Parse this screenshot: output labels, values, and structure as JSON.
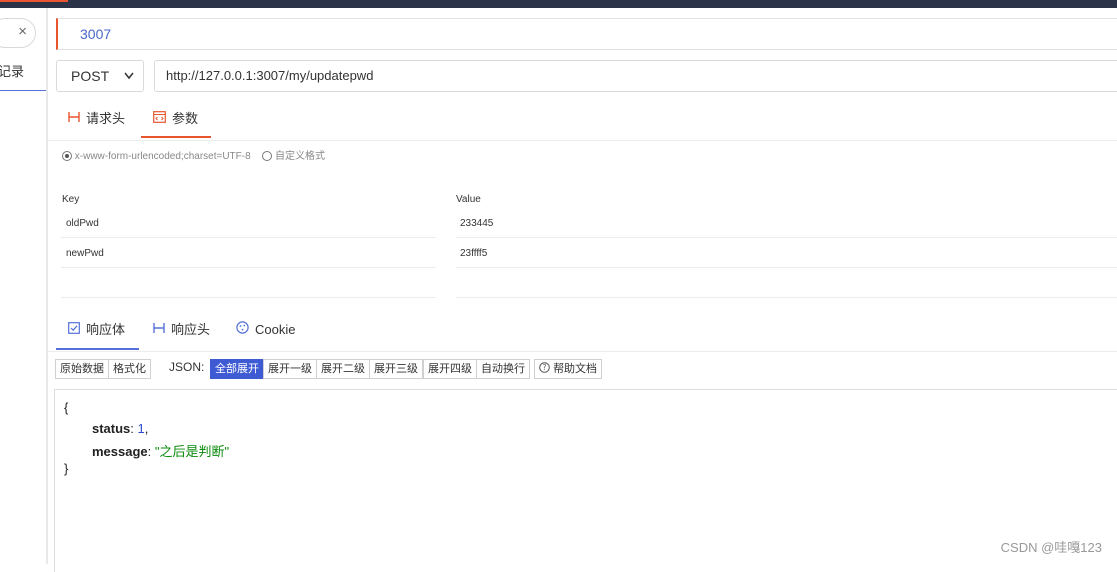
{
  "sidebar": {
    "close_glyph": "×",
    "tab_label": "记录"
  },
  "request": {
    "name": "3007",
    "method": "POST",
    "url": "http://127.0.0.1:3007/my/updatepwd"
  },
  "request_tabs": [
    {
      "icon": "header-icon",
      "label": "请求头",
      "active": false
    },
    {
      "icon": "params-icon",
      "label": "参数",
      "active": true
    }
  ],
  "body_format": {
    "options": [
      {
        "label": "x-www-form-urlencoded;charset=UTF-8",
        "selected": true
      },
      {
        "label": "自定义格式",
        "selected": false
      }
    ]
  },
  "params": {
    "key_header": "Key",
    "value_header": "Value",
    "rows": [
      {
        "key": "oldPwd",
        "value": "233445"
      },
      {
        "key": "newPwd",
        "value": "23ffff5"
      }
    ]
  },
  "response_tabs": [
    {
      "icon": "check-square-icon",
      "label": "响应体",
      "active": true
    },
    {
      "icon": "header-icon",
      "label": "响应头",
      "active": false
    },
    {
      "icon": "cookie-icon",
      "label": "Cookie",
      "active": false
    }
  ],
  "toolbar": {
    "raw_label": "原始数据",
    "format_label": "格式化",
    "json_label": "JSON:",
    "expand_buttons": [
      "全部展开",
      "展开一级",
      "展开二级",
      "展开三级",
      "展开四级",
      "自动换行"
    ],
    "help_label": "帮助文档"
  },
  "response_body": {
    "open": "{",
    "close": "}",
    "fields": [
      {
        "key": "status",
        "value": "1",
        "type": "number"
      },
      {
        "key": "message",
        "value": "\"之后是判断\"",
        "type": "string"
      }
    ]
  },
  "watermark": "CSDN @哇嘎123",
  "colors": {
    "accent": "#e8552f",
    "primary": "#3f5bd4",
    "string": "#0a8a0a",
    "number": "#2d49c9"
  }
}
